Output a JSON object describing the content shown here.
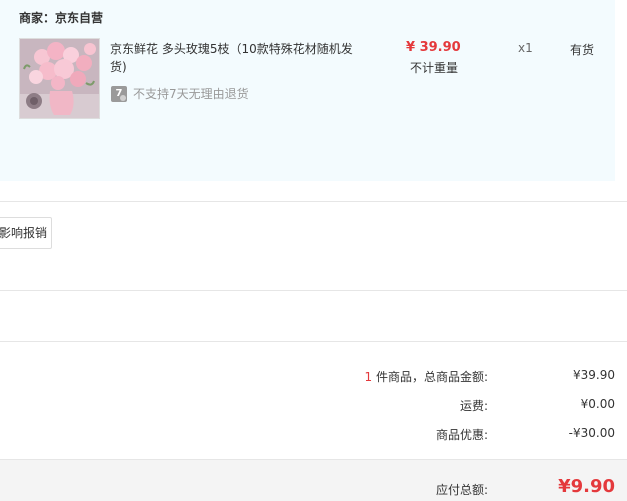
{
  "merchant": {
    "label": "商家：京东自营"
  },
  "product": {
    "image_icon": "pink-rose-bouquet-image",
    "title": "京东鲜花 多头玫瑰5枝（10款特殊花材随机发货)",
    "service_icon_text": "7",
    "service_note": "不支持7天无理由退货",
    "price": "¥ 39.90",
    "weight": "不计重量",
    "quantity": "x1",
    "stock": "有货"
  },
  "invoice": {
    "button_label": "影响报销"
  },
  "summary": {
    "item_count": "1",
    "items_text": " 件商品，总商品金额:",
    "items_total": "¥39.90",
    "shipping_label": "运费:",
    "shipping_value": "¥0.00",
    "discount_label": "商品优惠:",
    "discount_value": "-¥30.00",
    "payable_label": "应付总额:",
    "payable_value": "¥9.90"
  },
  "colors": {
    "accent_red": "#e4393c",
    "panel_bg": "#f3fbfe"
  }
}
